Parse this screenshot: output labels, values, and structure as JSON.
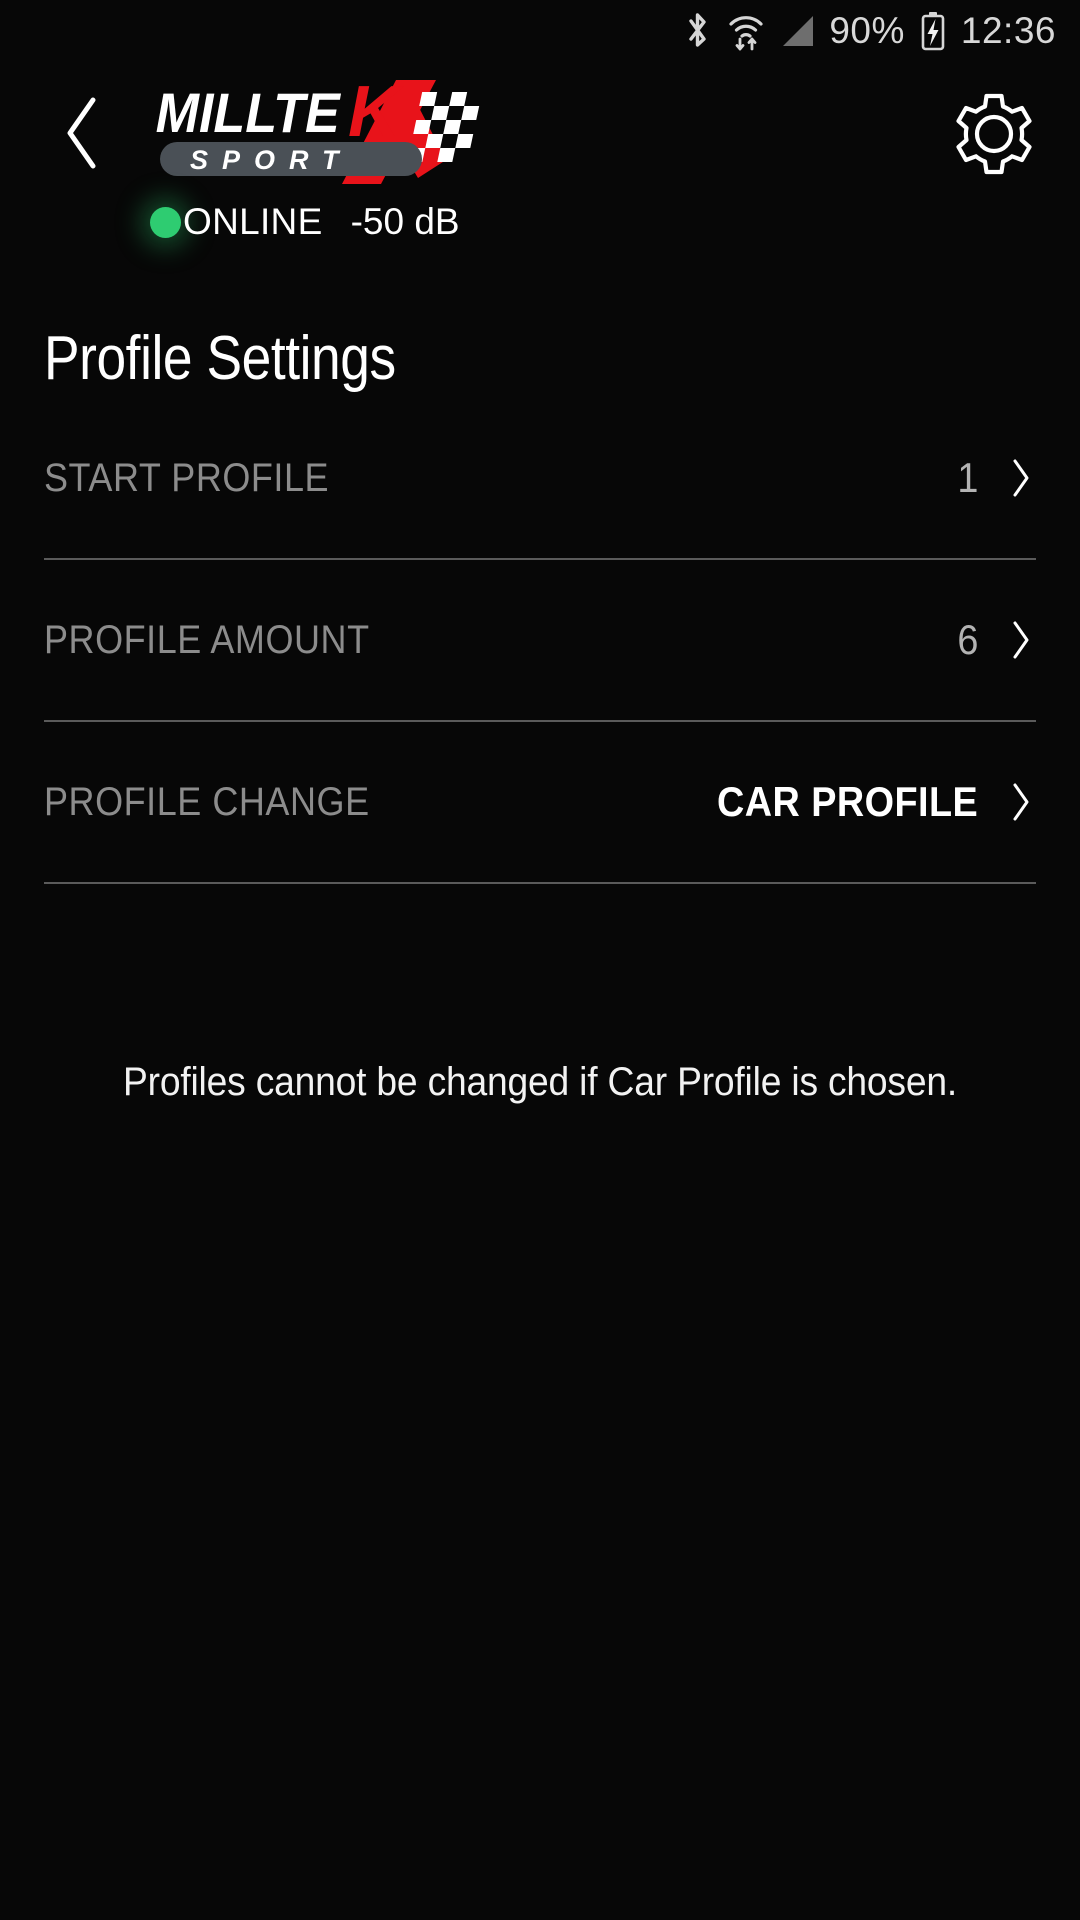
{
  "status_bar": {
    "bluetooth_icon": "bluetooth-icon",
    "wifi_icon": "wifi-data-icon",
    "signal_icon": "cell-signal-icon",
    "battery_percent": "90%",
    "battery_icon": "battery-charging-icon",
    "time": "12:36"
  },
  "header": {
    "back_icon": "back-chevron-icon",
    "settings_icon": "gear-icon",
    "logo": {
      "brand_main": "MILLTE",
      "brand_accent": "K",
      "brand_sub": "SPORT",
      "accent_color": "#e8131a",
      "badge_color": "#4a5056"
    }
  },
  "connection": {
    "dot_color": "#2ecc71",
    "state": "ONLINE",
    "level": "-50 dB"
  },
  "page": {
    "title": "Profile Settings"
  },
  "settings": {
    "rows": [
      {
        "label": "START PROFILE",
        "value": "1",
        "emphasis": false,
        "chevron": "chevron-right-icon"
      },
      {
        "label": "PROFILE AMOUNT",
        "value": "6",
        "emphasis": false,
        "chevron": "chevron-right-icon"
      },
      {
        "label": "PROFILE CHANGE",
        "value": "CAR PROFILE",
        "emphasis": true,
        "chevron": "chevron-right-icon"
      }
    ]
  },
  "footer": {
    "note": "Profiles cannot be changed if Car Profile is chosen."
  }
}
